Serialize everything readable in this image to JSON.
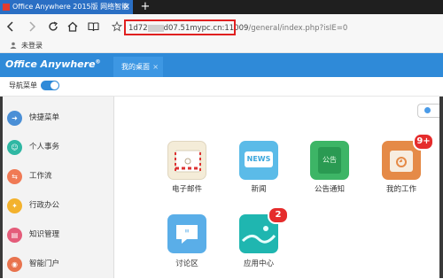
{
  "browser": {
    "tab_title": "Office Anywhere 2015版 网络智能",
    "tab_close": "×",
    "new_tab": "+",
    "url_prefix": "1d72",
    "url_middle": "d07.51mypc.cn:11009",
    "url_suffix": "/general/index.php?isIE=0",
    "bookmark": "未登录"
  },
  "app": {
    "logo": "Office Anywhere",
    "logo_mark": "®",
    "desk_tab": "我的桌面",
    "desk_tab_close": "×",
    "nav_label": "导航菜单"
  },
  "sidebar": {
    "items": [
      {
        "label": "快捷菜单",
        "icon": "arrow-icon",
        "color": "#4a8fd6"
      },
      {
        "label": "个人事务",
        "icon": "person-icon",
        "color": "#2fb7a3"
      },
      {
        "label": "工作流",
        "icon": "workflow-icon",
        "color": "#f07a55"
      },
      {
        "label": "行政办公",
        "icon": "briefcase-icon",
        "color": "#f3b22d"
      },
      {
        "label": "知识管理",
        "icon": "book-icon",
        "color": "#e45c7a"
      },
      {
        "label": "智能门户",
        "icon": "portal-icon",
        "color": "#e8734e"
      }
    ]
  },
  "desktop": {
    "apps": [
      {
        "label": "电子邮件",
        "icon": "mail-icon",
        "badge": ""
      },
      {
        "label": "新闻",
        "icon": "news-icon",
        "badge": "",
        "icon_text": "NEWS"
      },
      {
        "label": "公告通知",
        "icon": "notice-icon",
        "badge": "",
        "icon_text": "公告"
      },
      {
        "label": "我的工作",
        "icon": "work-icon",
        "badge": "9+"
      },
      {
        "label": "讨论区",
        "icon": "discussion-icon",
        "badge": ""
      },
      {
        "label": "应用中心",
        "icon": "app-center-icon",
        "badge": "2"
      }
    ]
  },
  "colors": {
    "header": "#2f8ad8",
    "highlight": "#e02020",
    "badge": "#e52c2c"
  }
}
